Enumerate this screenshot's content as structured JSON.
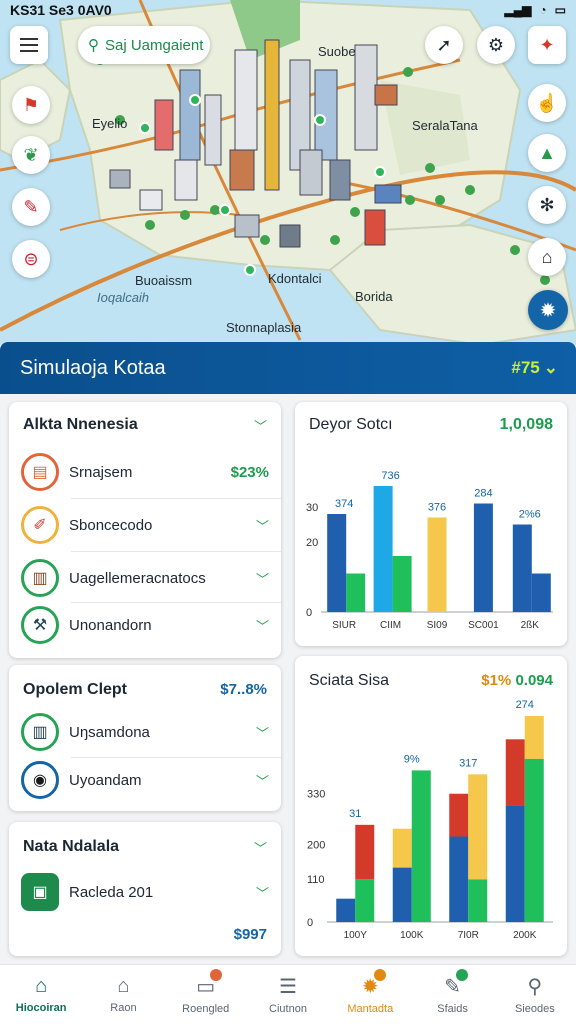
{
  "status": {
    "time": "KS31 Se3 0AV0"
  },
  "map": {
    "search_label": "Saj Uamgaient",
    "labels": [
      "Suobe",
      "Eyelio",
      "SeralaTana",
      "Buoaissm",
      "Kdontalci",
      "Borida",
      "Ioqalcaih",
      "Stonnaplasia"
    ]
  },
  "header": {
    "title": "Simulaoja Kotaa",
    "value": "#75"
  },
  "card_a": {
    "title": "Alkta Nnenesia",
    "items": [
      {
        "label": "Srnajsem",
        "value": "$23%"
      },
      {
        "label": "Sboncecodo"
      },
      {
        "label": "Uagellemeracnatocs"
      },
      {
        "label": "Unonandorn"
      }
    ]
  },
  "card_b": {
    "title": "Opolem Clept",
    "value": "$7..8%",
    "items": [
      {
        "label": "Uŋsamdona"
      },
      {
        "label": "Uyoandam"
      }
    ]
  },
  "card_c": {
    "title": "Nata Ndalala",
    "item": "Racleda 201",
    "value": "$997"
  },
  "chart1_card": {
    "title": "Deyor Sotcı",
    "value": "1,0,098"
  },
  "chart2_card": {
    "title": "Sciata Sisa",
    "value_a": "$1%",
    "value_b": "0.094"
  },
  "colors": {
    "primary": "#0f5fa6",
    "green": "#1fbf5b",
    "blue": "#1f5fae",
    "red": "#d33a2a",
    "yellow": "#f5c84b",
    "sky": "#1fa8e6"
  },
  "chart_data": [
    {
      "type": "bar",
      "title": "Deyor Sotcı",
      "categories": [
        "SIUR",
        "CIIM",
        "SI09",
        "SC001",
        "2ßK"
      ],
      "yticks": [
        "30",
        "20",
        "0"
      ],
      "ylim": [
        0,
        40
      ],
      "series": [
        {
          "values": [
            28,
            36,
            27,
            31,
            25
          ]
        },
        {
          "values": [
            11,
            16,
            0,
            0,
            11
          ]
        }
      ],
      "bar_colors": [
        "#1f5fae",
        "#1fbf5b",
        "#1fa8e6",
        "#1fbf5b",
        "#f5c84b",
        "#1fa8e6",
        "#1f5fae",
        "#1fbf5b"
      ],
      "data_labels": [
        "374",
        "736",
        "376",
        "284",
        "2%6"
      ]
    },
    {
      "type": "bar",
      "stacked": true,
      "title": "Sciata Sisa",
      "categories": [
        "100Y",
        "100K",
        "7I0R",
        "200K"
      ],
      "yticks": [
        "330",
        "200",
        "110",
        "0"
      ],
      "ylim": [
        0,
        400
      ],
      "groups": [
        {
          "bars": [
            {
              "stack": [
                {
                  "value": 60,
                  "color": "#1f5fae"
                }
              ]
            },
            {
              "stack": [
                {
                  "value": 110,
                  "color": "#1fbf5b"
                },
                {
                  "value": 140,
                  "color": "#d33a2a"
                }
              ]
            }
          ]
        },
        {
          "bars": [
            {
              "stack": [
                {
                  "value": 140,
                  "color": "#1f5fae"
                },
                {
                  "value": 100,
                  "color": "#f5c84b"
                }
              ]
            },
            {
              "stack": [
                {
                  "value": 390,
                  "color": "#1fbf5b"
                }
              ]
            }
          ]
        },
        {
          "bars": [
            {
              "stack": [
                {
                  "value": 220,
                  "color": "#1f5fae"
                },
                {
                  "value": 110,
                  "color": "#d33a2a"
                }
              ]
            },
            {
              "stack": [
                {
                  "value": 110,
                  "color": "#1fbf5b"
                },
                {
                  "value": 270,
                  "color": "#f5c84b"
                }
              ]
            }
          ]
        },
        {
          "bars": [
            {
              "stack": [
                {
                  "value": 300,
                  "color": "#1f5fae"
                },
                {
                  "value": 170,
                  "color": "#d33a2a"
                }
              ]
            },
            {
              "stack": [
                {
                  "value": 420,
                  "color": "#1fbf5b"
                },
                {
                  "value": 110,
                  "color": "#f5c84b"
                }
              ]
            }
          ]
        }
      ],
      "data_labels": [
        "31",
        "9%",
        "317",
        "274"
      ]
    }
  ],
  "nav": [
    {
      "label": "Hiocoiran",
      "icon": "home-icon"
    },
    {
      "label": "Raon",
      "icon": "building-icon"
    },
    {
      "label": "Roengled",
      "icon": "calendar-icon"
    },
    {
      "label": "Ciutnon",
      "icon": "list-icon"
    },
    {
      "label": "Mantadta",
      "icon": "gear-icon"
    },
    {
      "label": "Sfaids",
      "icon": "edit-icon"
    },
    {
      "label": "Sieodes",
      "icon": "search-icon"
    }
  ]
}
